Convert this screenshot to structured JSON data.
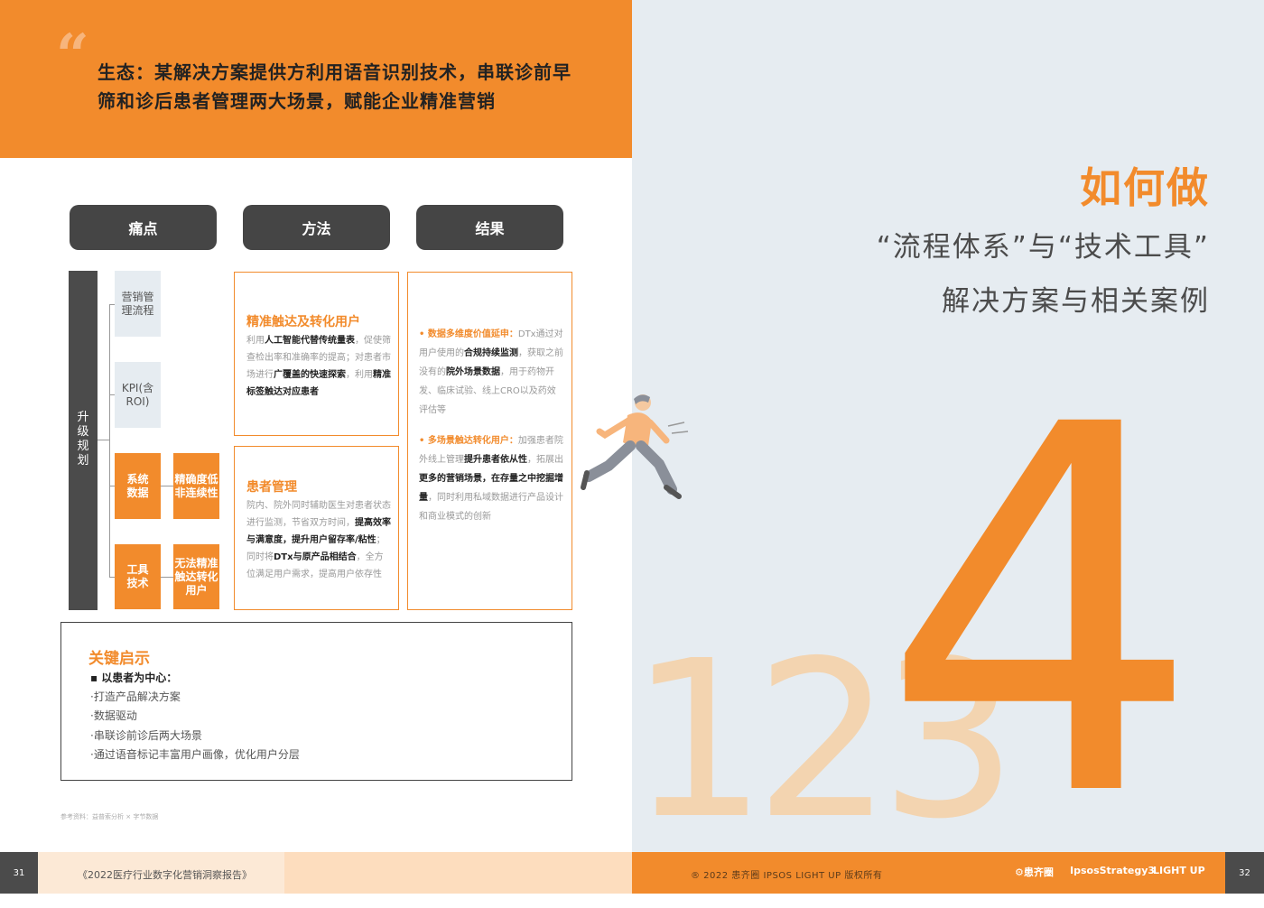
{
  "header": {
    "line1": "生态：某解决方案提供方利用语音识别技术，串联诊前早",
    "line2": "筛和诊后患者管理两大场景，赋能企业精准营销"
  },
  "columns": {
    "pain": "痛点",
    "method": "方法",
    "result": "结果"
  },
  "vertical_label": "升\n级\n规\n划",
  "pain_points": {
    "marketing": "营销管\n理流程",
    "kpi": "KPI(含\nROI)",
    "system_data": "系统\n数据",
    "system_issue": "精确度低\n非连续性",
    "tool_tech": "工具\n技术",
    "tool_issue": "无法精准\n触达转化\n用户"
  },
  "methods": {
    "m1_title": "精准触达及转化用户",
    "m1_a": "利用",
    "m1_b": "人工智能代替传统量表",
    "m1_c": "，促使筛查检出率和准确率的提高；对患者市场进行",
    "m1_d": "广覆盖的快速探索",
    "m1_e": "，利用",
    "m1_f": "精准标签触达对应患者",
    "m2_title": "患者管理",
    "m2_a": "院内、院外同时辅助医生对患者状态进行监测，节省双方时间，",
    "m2_b": "提高效率与满意度，提升用户留存率/粘性",
    "m2_c": "；同时将",
    "m2_d": "DTx与原产品相结合",
    "m2_e": "，全方位满足用户需求，提高用户依存性"
  },
  "results": {
    "r1_head": "• 数据多维度价值延申：",
    "r1_a": "DTx通过对用户使用的",
    "r1_b": "合规持续监测",
    "r1_c": "，获取之前没有的",
    "r1_d": "院外场景数据",
    "r1_e": "，用于药物开发、临床试验、线上CRO以及药效评估等",
    "r2_head": "• 多场景触达转化用户：",
    "r2_a": "加强患者院外线上管理",
    "r2_b": "提升患者依从性",
    "r2_c": "，拓展出",
    "r2_d": "更多的营销场景，在存量之中挖掘增量",
    "r2_e": "，同时利用私域数据进行产品设计和商业模式的创新"
  },
  "insight": {
    "title": "关键启示",
    "items": [
      "▪ 以患者为中心：",
      "·打造产品解决方案",
      "·数据驱动",
      "·串联诊前诊后两大场景",
      "·通过语音标记丰富用户画像，优化用户分层"
    ]
  },
  "reference": "参考资料：益普索分析 × 字节数据",
  "footer_left": {
    "page_num": "31",
    "title": "《2022医疗行业数字化营销洞察报告》"
  },
  "right": {
    "title_how": "如何做",
    "title_line2": "“流程体系”与“技术工具”",
    "title_line3": "解决方案与相关案例",
    "big_faded": "123",
    "big_active": "4"
  },
  "footer_right": {
    "copyright": "® 2022 患齐圈 IPSOS LIGHT UP 版权所有",
    "logo1": "患齐圈",
    "logo2": "IpsosStrategy3",
    "logo3": "LIGHT UP",
    "page_num": "32"
  },
  "colors": {
    "accent": "#F28B2C",
    "dark": "#4B4B4B",
    "light_blue": "#E6ECF1",
    "peach": "#FCE9D6"
  }
}
